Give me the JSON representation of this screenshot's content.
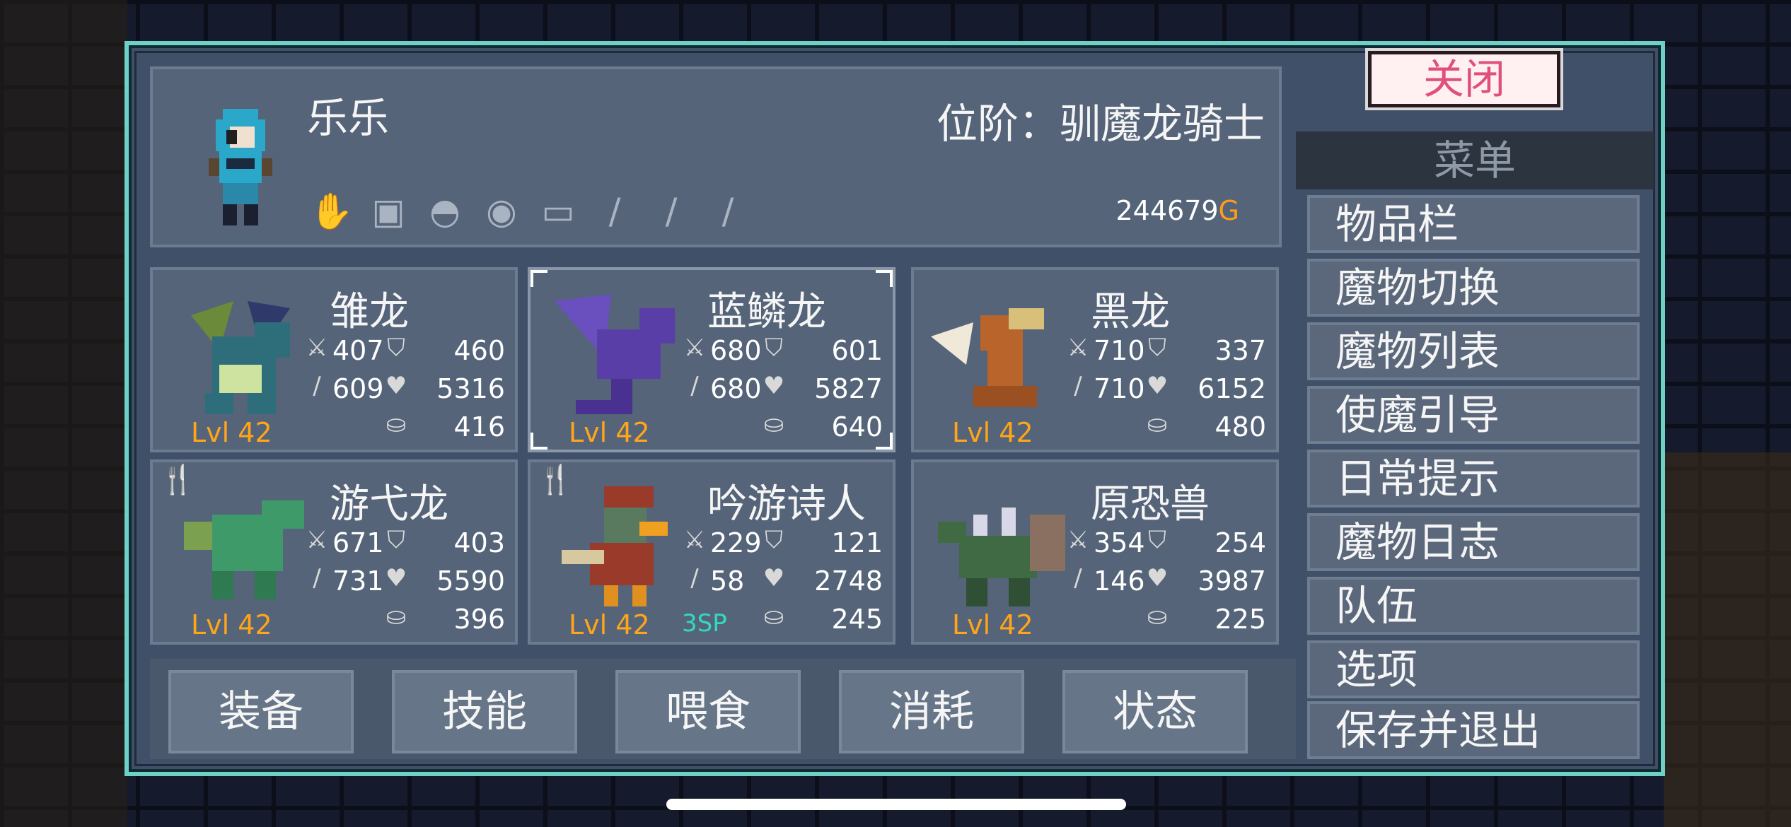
{
  "player": {
    "name": "乐乐",
    "rank_label": "位阶：",
    "rank_value": "驯魔龙骑士",
    "gold_amount": "244679",
    "gold_unit": "G"
  },
  "equip_slots": [
    "gauntlet-icon",
    "armor-icon",
    "helmet-icon",
    "ring-icon",
    "belt-icon",
    "feather-icon",
    "feather-icon",
    "feather-icon"
  ],
  "monsters": [
    {
      "name": "雏龙",
      "attack": "407",
      "defense": "460",
      "magic": "609",
      "health": "5316",
      "food": "416",
      "level": "Lvl 42",
      "sp": "",
      "color": "#2e6e7a"
    },
    {
      "name": "蓝鳞龙",
      "attack": "680",
      "defense": "601",
      "magic": "680",
      "health": "5827",
      "food": "640",
      "level": "Lvl 42",
      "sp": "",
      "color": "#5a3ea8"
    },
    {
      "name": "黑龙",
      "attack": "710",
      "defense": "337",
      "magic": "710",
      "health": "6152",
      "food": "480",
      "level": "Lvl 42",
      "sp": "",
      "color": "#b8642a"
    },
    {
      "name": "游弋龙",
      "attack": "671",
      "defense": "403",
      "magic": "731",
      "health": "5590",
      "food": "396",
      "level": "Lvl 42",
      "sp": "",
      "color": "#3f9a6a"
    },
    {
      "name": "吟游诗人",
      "attack": "229",
      "defense": "121",
      "magic": "58",
      "health": "2748",
      "food": "245",
      "level": "Lvl 42",
      "sp": "3SP",
      "color": "#9a3a2a"
    },
    {
      "name": "原恐兽",
      "attack": "354",
      "defense": "254",
      "magic": "146",
      "health": "3987",
      "food": "225",
      "level": "Lvl 42",
      "sp": "",
      "color": "#3f6a44"
    }
  ],
  "actions": [
    "装备",
    "技能",
    "喂食",
    "消耗",
    "状态"
  ],
  "menu": {
    "close_label": "关闭",
    "title": "菜单",
    "items": [
      "物品栏",
      "魔物切换",
      "魔物列表",
      "使魔引导",
      "日常提示",
      "魔物日志",
      "队伍",
      "选项",
      "保存并退出"
    ]
  },
  "colors": {
    "frame_accent": "#6fd0c8",
    "level": "#ffa51a",
    "gold": "#ff9d1a",
    "sp": "#33d9c0",
    "close_text": "#e0507a"
  }
}
